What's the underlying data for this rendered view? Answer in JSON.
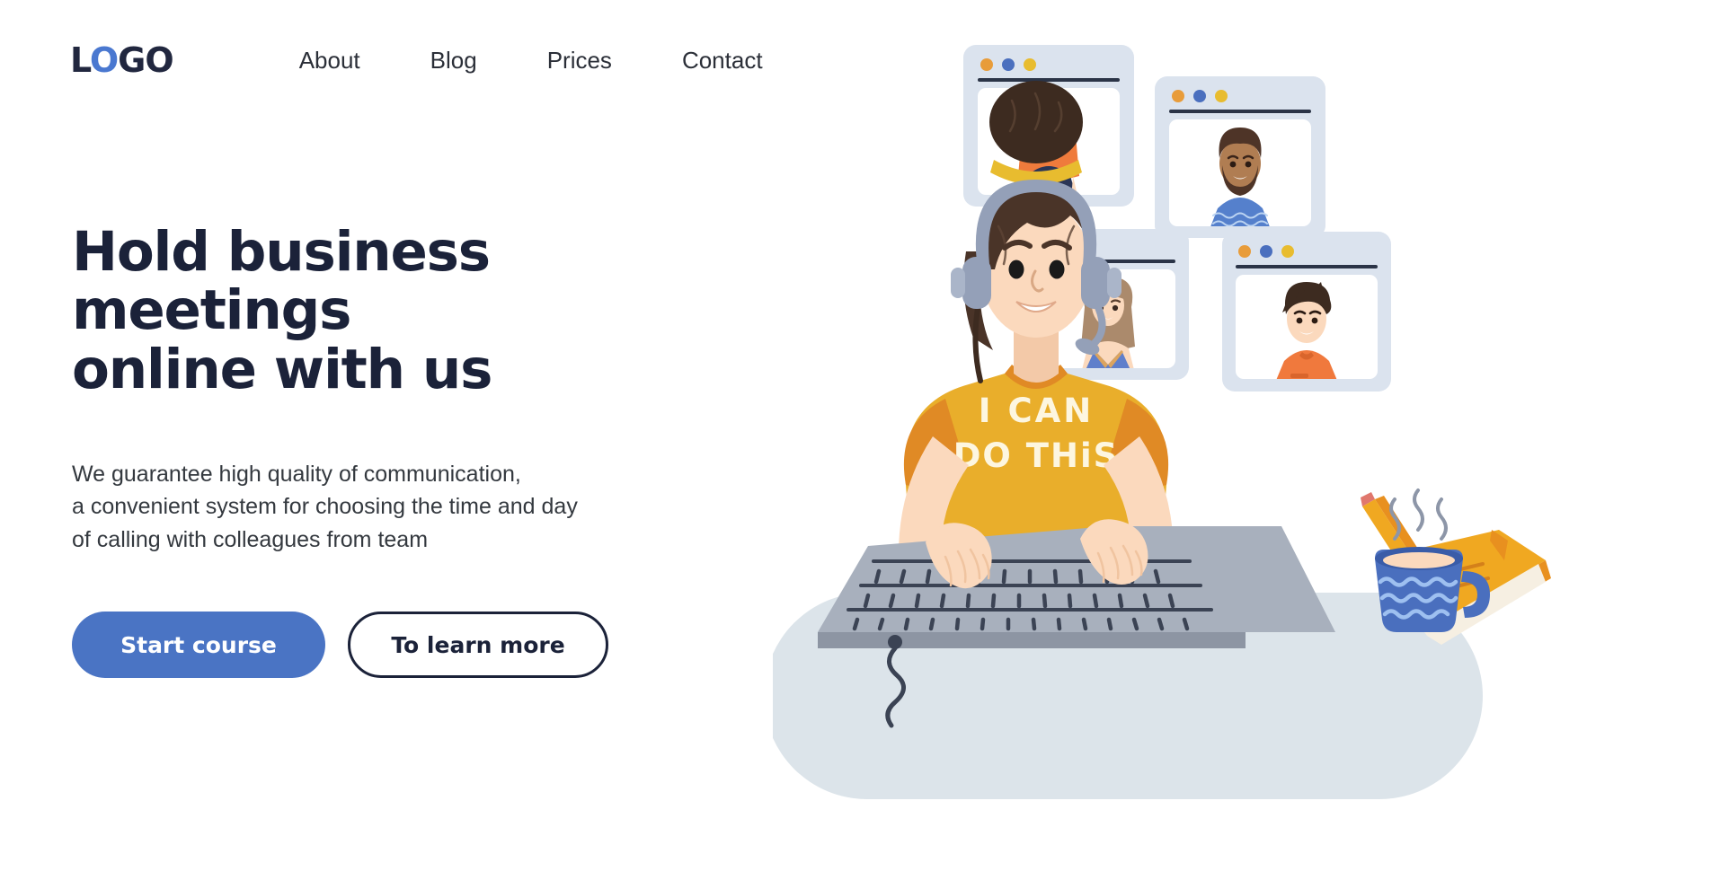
{
  "brand": {
    "logo_full": "LOGO",
    "logo_letters": [
      "L",
      "O",
      "G",
      "O"
    ],
    "logo_colors": [
      "#21273f",
      "#4a78d0",
      "#21273f",
      "#21273f"
    ]
  },
  "nav": {
    "items": [
      {
        "label": "About"
      },
      {
        "label": "Blog"
      },
      {
        "label": "Prices"
      },
      {
        "label": "Contact"
      }
    ]
  },
  "hero": {
    "headline": "Hold business meetings\nonline with us",
    "subhead": "We guarantee high quality of communication,\na convenient system for choosing the time and day\nof calling with colleagues from team",
    "primary_cta": "Start course",
    "secondary_cta": "To learn more"
  },
  "colors": {
    "accent_blue": "#4a74c4",
    "headline_navy": "#1b2239",
    "shirt_yellow": "#e9ae2b",
    "shirt_yellow_dark": "#e08a25",
    "desk_grey": "#dce4ea",
    "window_chrome": "#dbe3ee",
    "skin": "#fbd9bd",
    "hair_brown": "#4a3428",
    "headset_grey": "#94a0b8",
    "keyboard_grey": "#a8b0bd",
    "mug_blue": "#4a6fbe",
    "notebook_orange": "#f0a821",
    "pencil_orange": "#e8901f"
  },
  "illustration": {
    "operator": {
      "shirt_text_line1": "I CAN",
      "shirt_text_line2": "DO THiS",
      "accessory": "headset-with-microphone",
      "hairstyle": "dark-brown-bun-with-yellow-tie"
    },
    "desk_items": [
      {
        "name": "pencil"
      },
      {
        "name": "notebook"
      },
      {
        "name": "coffee-mug"
      },
      {
        "name": "keyboard"
      }
    ],
    "video_windows": [
      {
        "id": "window-1",
        "participant": "red-haired-woman",
        "hair": "#ef7b3c",
        "top": "#2b3656",
        "dots": [
          "#e89c3a",
          "#4a6fbe",
          "#e8bc2f"
        ]
      },
      {
        "id": "window-2",
        "participant": "bearded-man",
        "hair": "#4e3427",
        "top": "#5580cc",
        "dots": [
          "#e89c3a",
          "#4a6fbe",
          "#e8bc2f"
        ]
      },
      {
        "id": "window-3",
        "participant": "curly-haired-woman",
        "hair": "#ab8a6c",
        "top": "#5f7fcb",
        "dots": [
          "#e89c3a",
          "#4a6fbe",
          "#e8bc2f"
        ]
      },
      {
        "id": "window-4",
        "participant": "young-man",
        "hair": "#3d2b20",
        "top": "#f0793d",
        "dots": [
          "#e89c3a",
          "#4a6fbe",
          "#e8bc2f"
        ]
      }
    ]
  }
}
